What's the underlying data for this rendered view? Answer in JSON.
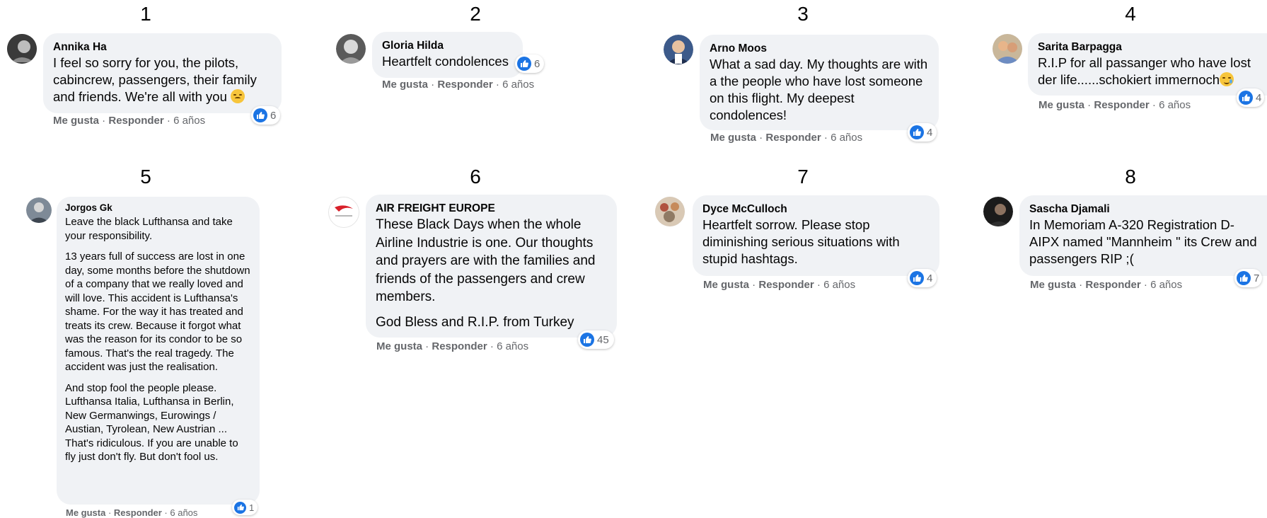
{
  "comments": [
    {
      "num": "1",
      "author": "Annika Ha",
      "text": "I feel so sorry for you, the pilots, cabincrew, passengers, their family and friends. We're all with you",
      "emoji": "disappointed",
      "like_label": "Me gusta",
      "reply_label": "Responder",
      "time": "6 años",
      "reactions": "6"
    },
    {
      "num": "2",
      "author": "Gloria Hilda",
      "text": "Heartfelt condolences",
      "like_label": "Me gusta",
      "reply_label": "Responder",
      "time": "6 años",
      "reactions": "6"
    },
    {
      "num": "3",
      "author": "Arno Moos",
      "text": "What a sad day. My thoughts are with a the people who have lost someone on this flight. My deepest condolences!",
      "like_label": "Me gusta",
      "reply_label": "Responder",
      "time": "6 años",
      "reactions": "4"
    },
    {
      "num": "4",
      "author": "Sarita Barpagga",
      "text": "R.I.P for all passanger who have lost der life......schokiert immernoch",
      "emoji": "crying",
      "like_label": "Me gusta",
      "reply_label": "Responder",
      "time": "6 años",
      "reactions": "4"
    },
    {
      "num": "5",
      "author": "Jorgos Gk",
      "paragraphs": [
        "Leave the black Lufthansa and take your responsibility.",
        "13 years full of success are lost in one day, some months before the shutdown of a company that we really loved and will love. This accident is Lufthansa's shame. For the way it has treated and treats its crew. Because it forgot what was the reason for its condor to be so famous. That's the real tragedy. The accident was just the realisation.",
        "And stop fool the people please. Lufthansa Italia, Lufthansa in Berlin, New Germanwings, Eurowings / Austian, Tyrolean, New Austrian ... That's ridiculous. If you are unable to fly just don't fly. But don't fool us."
      ],
      "like_label": "Me gusta",
      "reply_label": "Responder",
      "time": "6 años",
      "reactions": "1"
    },
    {
      "num": "6",
      "author": "AIR FREIGHT EUROPE",
      "paragraphs": [
        "These Black Days when the whole Airline Industrie is one. Our thoughts and prayers are with the families and friends of the passengers and crew members.",
        "God Bless and R.I.P. from Turkey"
      ],
      "like_label": "Me gusta",
      "reply_label": "Responder",
      "time": "6 años",
      "reactions": "45"
    },
    {
      "num": "7",
      "author": "Dyce McCulloch",
      "text": "Heartfelt sorrow. Please stop diminishing serious situations with stupid hashtags.",
      "like_label": "Me gusta",
      "reply_label": "Responder",
      "time": "6 años",
      "reactions": "4"
    },
    {
      "num": "8",
      "author": "Sascha Djamali",
      "text": "In Memoriam A-320 Registration D-AIPX named \"Mannheim \" its Crew and passengers RIP ;(",
      "like_label": "Me gusta",
      "reply_label": "Responder",
      "time": "6 años",
      "reactions": "7"
    }
  ],
  "colors": {
    "bubble": "#f0f2f5",
    "meta": "#65676b",
    "like_blue": "#1b74e4"
  },
  "icons": [
    "thumbs-up-icon"
  ]
}
